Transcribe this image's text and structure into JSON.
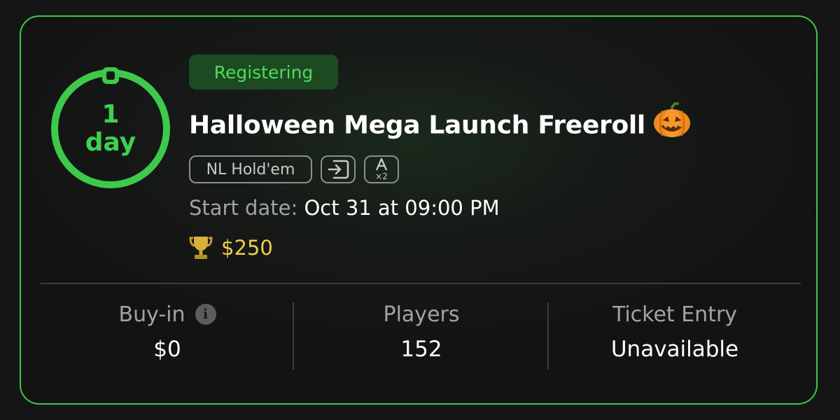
{
  "timer": {
    "number": "1",
    "unit": "day",
    "color": "#3ec94b"
  },
  "tournament": {
    "status": "Registering",
    "title": "Halloween Mega Launch Freeroll",
    "title_emoji_icon": "pumpkin-icon",
    "tags": {
      "game_type": "NL Hold'em",
      "late_entry_icon": "enter-icon",
      "rebuy_icon": "ace-x2-icon",
      "rebuy_mult": "×2"
    },
    "start_label": "Start date:",
    "start_value": "Oct 31 at 09:00 PM",
    "prize_icon": "trophy-icon",
    "prize": "$250"
  },
  "stats": {
    "buyin_label": "Buy-in",
    "buyin_value": "$0",
    "players_label": "Players",
    "players_value": "152",
    "ticket_label": "Ticket Entry",
    "ticket_value": "Unavailable"
  },
  "colors": {
    "accent": "#3ec94b",
    "prize": "#f2cc4f",
    "background": "#151515"
  }
}
